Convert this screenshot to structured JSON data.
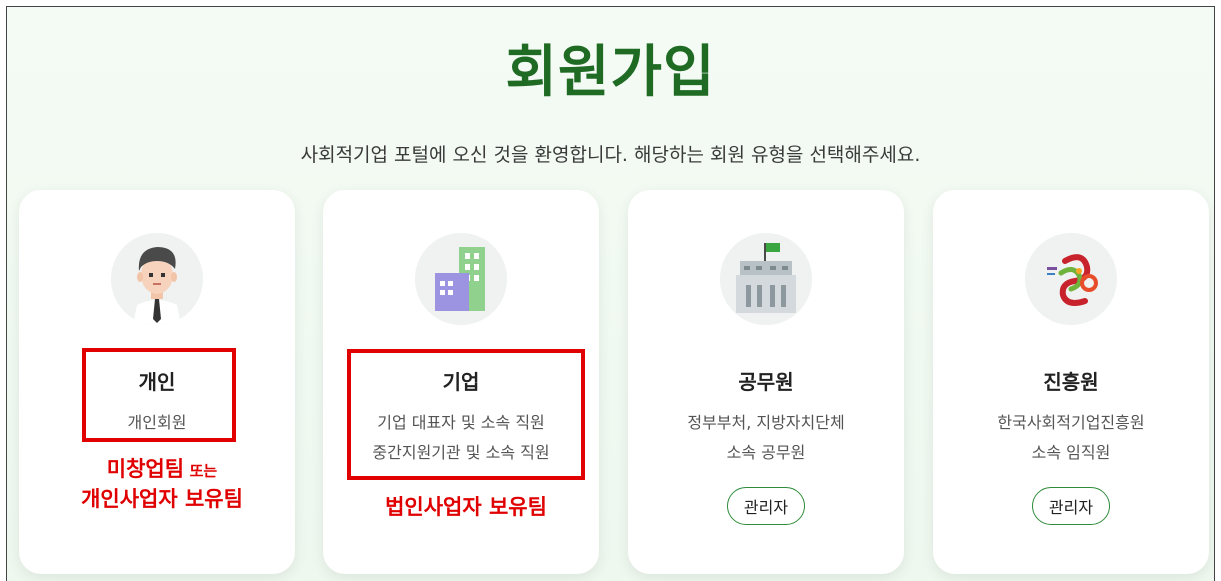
{
  "page": {
    "title": "회원가입",
    "subtitle": "사회적기업 포털에 오신 것을 환영합니다. 해당하는 회원 유형을 선택해주세요."
  },
  "cards": [
    {
      "icon": "person-avatar-icon",
      "name": "개인",
      "desc_lines": [
        "개인회원"
      ]
    },
    {
      "icon": "building-icon",
      "name": "기업",
      "desc_lines": [
        "기업 대표자 및 소속 직원",
        "중간지원기관 및 소속 직원"
      ]
    },
    {
      "icon": "government-building-icon",
      "name": "공무원",
      "desc_lines": [
        "정부부처, 지방자치단체",
        "소속 공무원"
      ],
      "button": "관리자"
    },
    {
      "icon": "agency-logo-icon",
      "name": "진흥원",
      "desc_lines": [
        "한국사회적기업진흥원",
        "소속 임직원"
      ],
      "button": "관리자"
    }
  ],
  "annotations": {
    "individual_line1_big": "미창업팀",
    "individual_line1_small": "또는",
    "individual_line2": "개인사업자 보유팀",
    "company": "법인사업자 보유팀"
  },
  "colors": {
    "title": "#1f6b24",
    "annotation": "#e00000",
    "button_border": "#2e8b3a"
  }
}
